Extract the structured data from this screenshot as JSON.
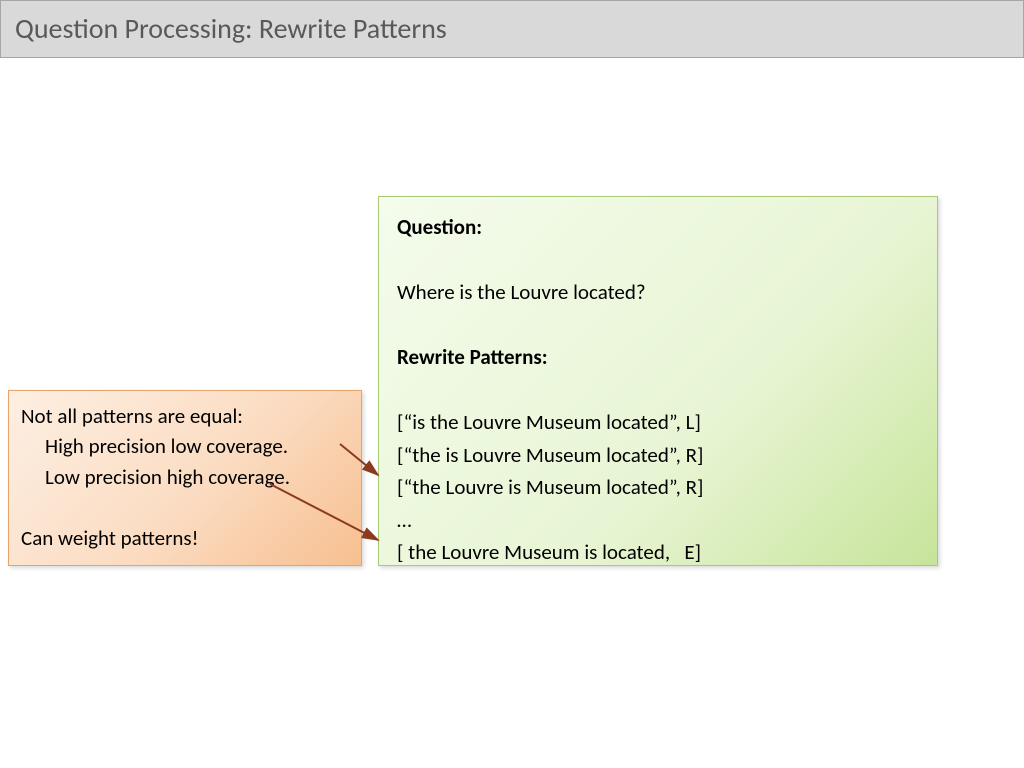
{
  "title": "Question Processing: Rewrite Patterns",
  "green": {
    "q_label": "Question:",
    "q_text": "Where is the Louvre located?",
    "rp_label": "Rewrite Patterns:",
    "p1": "[“is the Louvre Museum located”, L]",
    "p2": "[“the is Louvre Museum located”, R]",
    "p3": "[“the Louvre is Museum located”, R]",
    "ellipsis": "…",
    "p4": "[ the Louvre Museum is located,   E]"
  },
  "orange": {
    "l1": "Not all patterns are equal:",
    "l2": "High precision low coverage.",
    "l3": "Low precision high coverage.",
    "l4": "Can weight patterns!"
  }
}
